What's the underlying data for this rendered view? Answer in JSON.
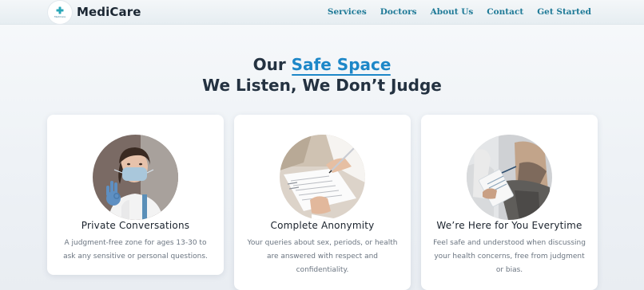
{
  "brand": {
    "name": "MediCare",
    "logo_small": "MediCare"
  },
  "nav": {
    "links": [
      "Services",
      "Doctors",
      "About Us",
      "Contact",
      "Get Started"
    ]
  },
  "hero": {
    "prefix": "Our ",
    "accent": "Safe Space",
    "subtitle": "We Listen, We Don’t Judge"
  },
  "cards": [
    {
      "title": "Private Conversations",
      "description": "A judgment-free zone for ages 13-30 to ask any sensitive or personal questions.",
      "image": "doctor-ok-gesture-photo"
    },
    {
      "title": "Complete Anonymity",
      "description": "Your queries about sex, periods, or health are answered with respect and confidentiality.",
      "image": "doctor-writing-notes-photo"
    },
    {
      "title": "We’re Here for You Everytime",
      "description": "Feel safe and understood when discussing your health concerns, free from judgment or bias.",
      "image": "patient-consultation-photo"
    }
  ],
  "colors": {
    "accent": "#1d87c8",
    "nav_link": "#1f7a97",
    "heading": "#243241"
  }
}
